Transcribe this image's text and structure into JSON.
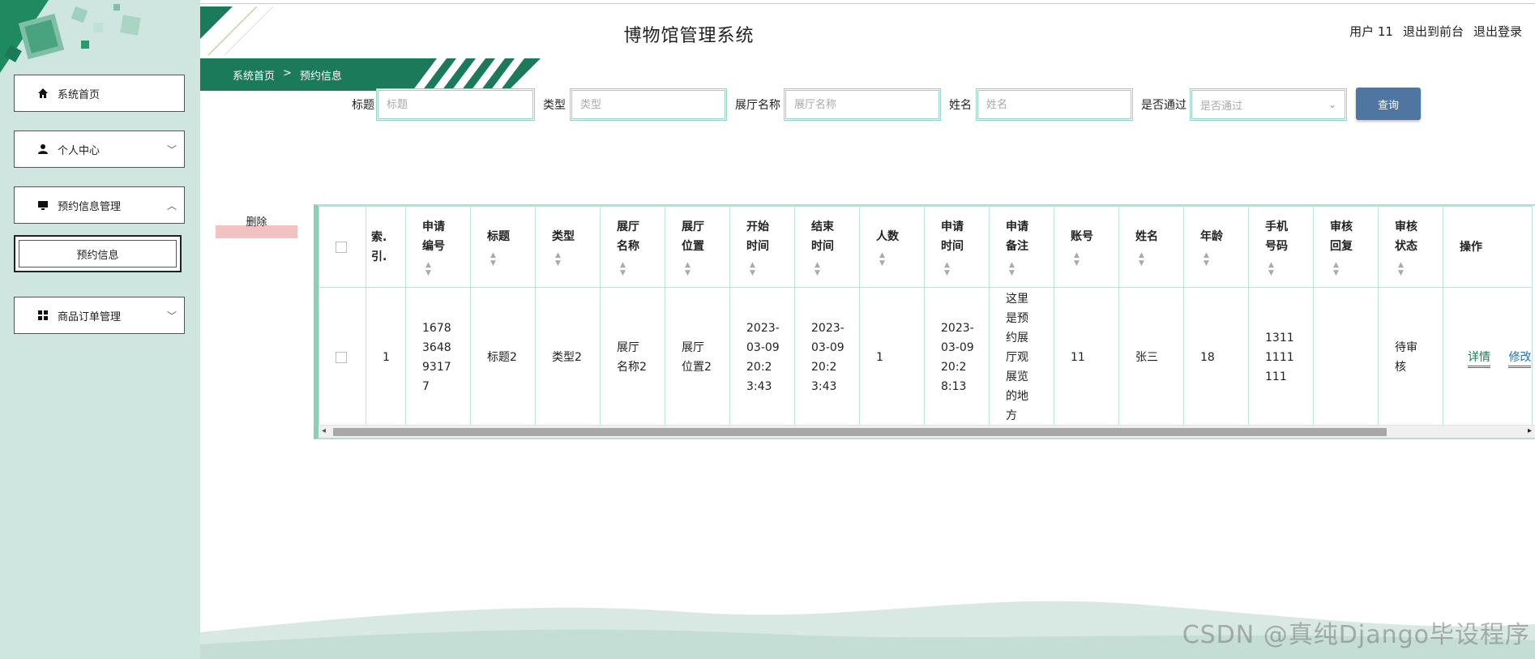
{
  "header": {
    "title": "博物馆管理系统",
    "user_label": "用户 11",
    "to_front_label": "退出到前台",
    "logout_label": "退出登录"
  },
  "sidebar": {
    "items": [
      {
        "label": "系统首页",
        "icon": "home-icon",
        "caret": ""
      },
      {
        "label": "个人中心",
        "icon": "person-icon",
        "caret": "﹀"
      },
      {
        "label": "预约信息管理",
        "icon": "monitor-icon",
        "caret": "︿"
      },
      {
        "label": "商品订单管理",
        "icon": "grid-icon",
        "caret": "﹀"
      }
    ],
    "sub_item": "预约信息"
  },
  "breadcrumb": {
    "home": "系统首页",
    "separator": ">",
    "current": "预约信息"
  },
  "search": {
    "title_label": "标题",
    "title_placeholder": "标题",
    "type_label": "类型",
    "type_placeholder": "类型",
    "hall_label": "展厅名称",
    "hall_placeholder": "展厅名称",
    "name_label": "姓名",
    "name_placeholder": "姓名",
    "pass_label": "是否通过",
    "pass_selected": "是否通过",
    "query_label": "查询"
  },
  "actions": {
    "delete_label": "删除"
  },
  "table": {
    "columns": [
      "索.\n引.",
      "申请\n编号",
      "标题",
      "类型",
      "展厅\n名称",
      "展厅\n位置",
      "开始\n时间",
      "结束\n时间",
      "人数",
      "申请\n时间",
      "申请\n备注",
      "账号",
      "姓名",
      "年龄",
      "手机\n号码",
      "审核\n回复",
      "审核\n状态",
      "操作"
    ],
    "rows": [
      {
        "index": "1",
        "apply_no": "1678\n3648\n9317\n7",
        "title": "标题2",
        "type": "类型2",
        "hall_name": "展厅\n名称2",
        "hall_location": "展厅\n位置2",
        "start_time": "2023-\n03-09\n20:2\n3:43",
        "end_time": "2023-\n03-09\n20:2\n3:43",
        "people": "1",
        "apply_time": "2023-\n03-09\n20:2\n8:13",
        "remark": "这里\n是预\n约展\n厅观\n展览\n的地\n方",
        "account": "11",
        "name": "张三",
        "age": "18",
        "phone": "1311\n1111\n111",
        "review_reply": "",
        "review_status": "待审\n核",
        "op_detail": "详情",
        "op_edit": "修改"
      }
    ]
  },
  "watermark": "CSDN @真纯Django毕设程序",
  "colors": {
    "sidebar_bg": "#cfe6e0",
    "brand_green": "#1b7a5a",
    "query_btn": "#4e76a0",
    "delete_bar": "#f3c1c0",
    "table_border": "#bfe1d6"
  }
}
